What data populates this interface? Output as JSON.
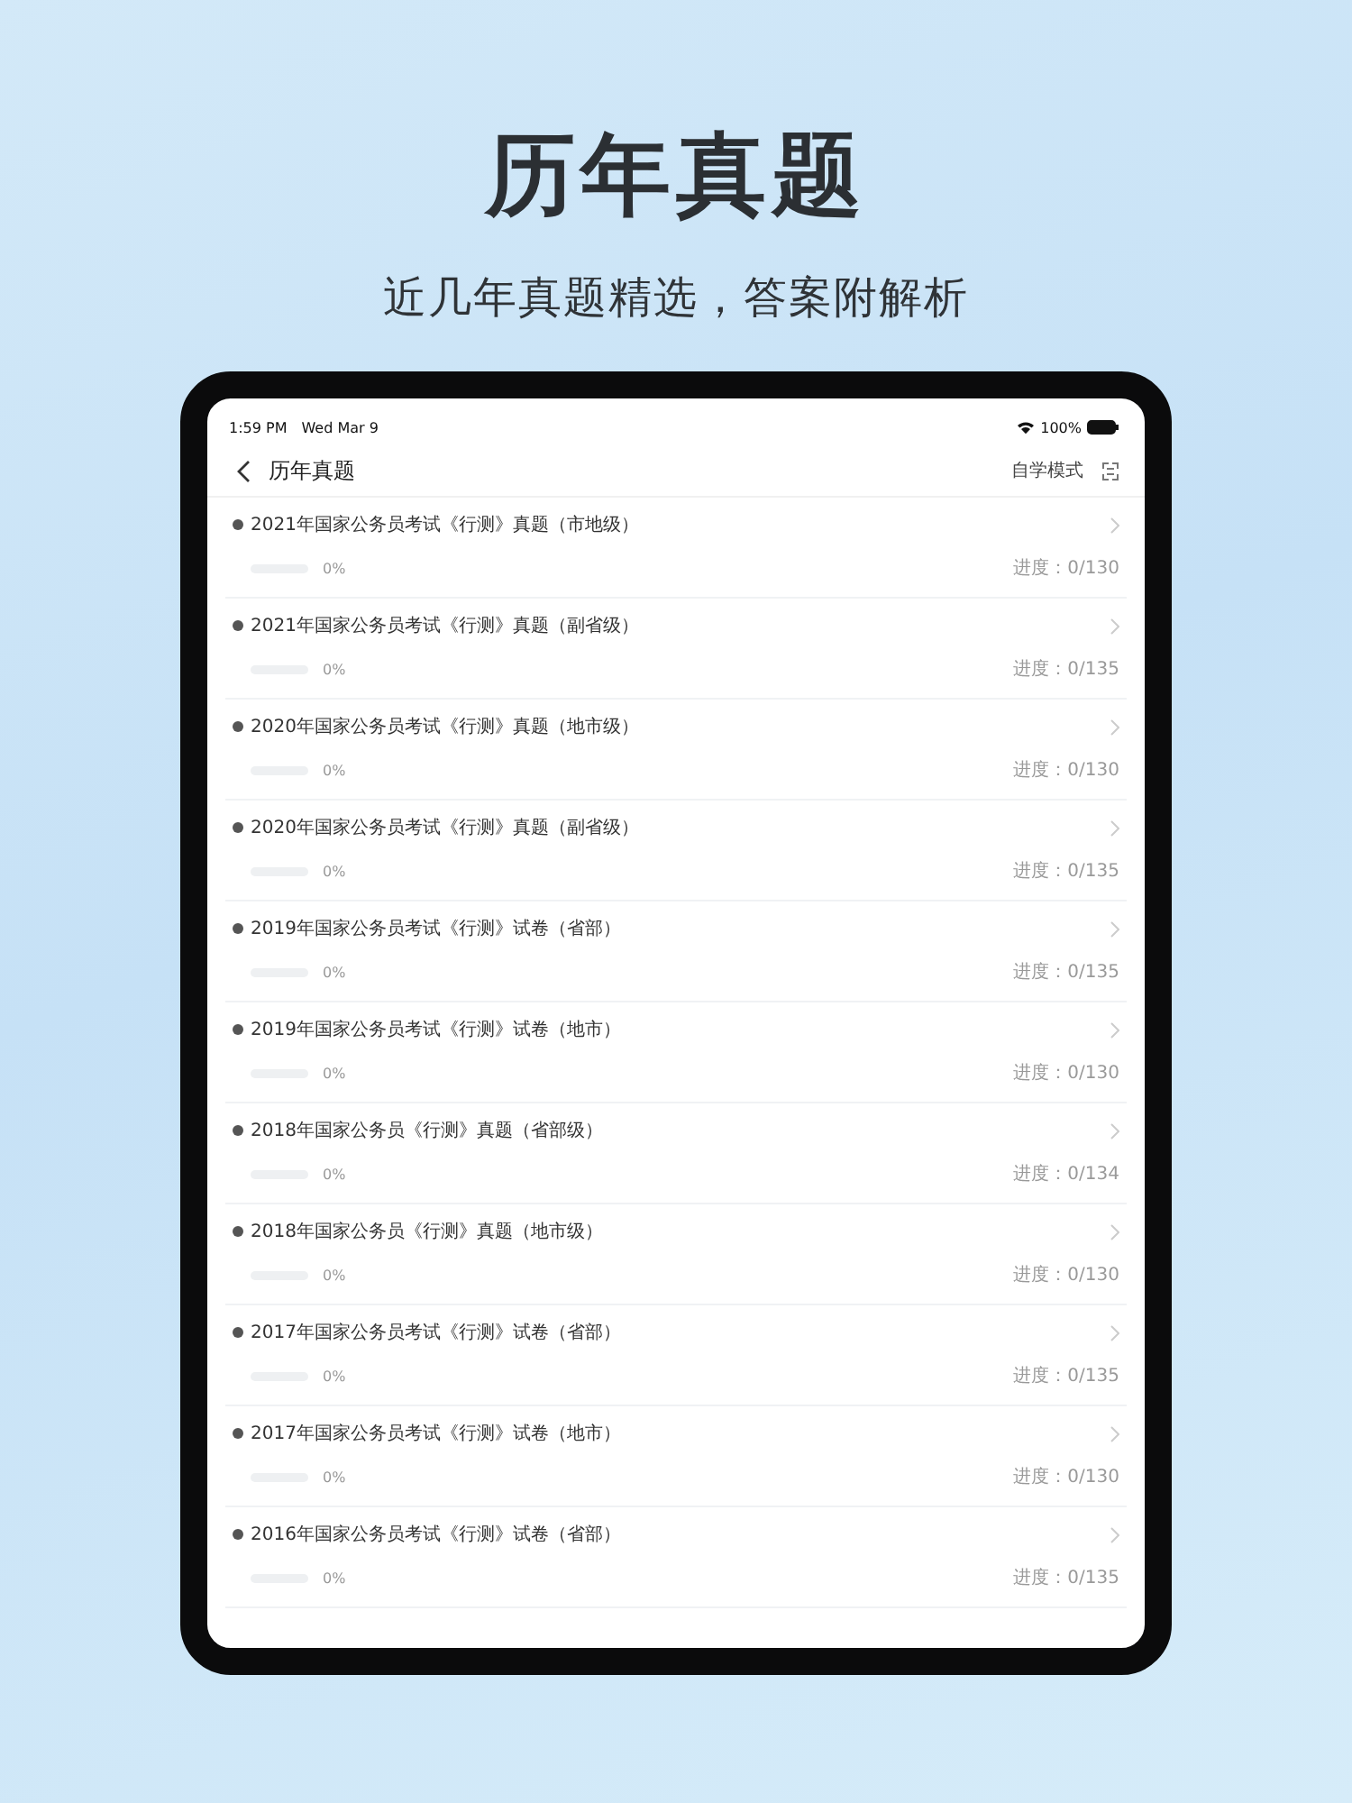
{
  "headline": "历年真题",
  "subtitle": "近几年真题精选，答案附解析",
  "status_bar": {
    "time": "1:59 PM",
    "date": "Wed Mar 9",
    "battery": "100%"
  },
  "nav": {
    "title": "历年真题",
    "mode": "自学模式"
  },
  "papers": [
    {
      "title": "2021年国家公务员考试《行测》真题（市地级）",
      "level": 0,
      "percent": "0%",
      "progress": "进度：0/130"
    },
    {
      "title": "2021年国家公务员考试《行测》真题（副省级）",
      "level": 0,
      "percent": "0%",
      "progress": "进度：0/135"
    },
    {
      "title": "2020年国家公务员考试《行测》真题（地市级）",
      "level": 0,
      "percent": "0%",
      "progress": "进度：0/130"
    },
    {
      "title": "2020年国家公务员考试《行测》真题（副省级）",
      "level": 0,
      "percent": "0%",
      "progress": "进度：0/135"
    },
    {
      "title": "2019年国家公务员考试《行测》试卷（省部）",
      "level": 0,
      "percent": "0%",
      "progress": "进度：0/135"
    },
    {
      "title": "2019年国家公务员考试《行测》试卷（地市）",
      "level": 0,
      "percent": "0%",
      "progress": "进度：0/130"
    },
    {
      "title": "2018年国家公务员《行测》真题（省部级）",
      "level": 0,
      "percent": "0%",
      "progress": "进度：0/134"
    },
    {
      "title": "2018年国家公务员《行测》真题（地市级）",
      "level": 0,
      "percent": "0%",
      "progress": "进度：0/130"
    },
    {
      "title": "2017年国家公务员考试《行测》试卷（省部）",
      "level": 0,
      "percent": "0%",
      "progress": "进度：0/135"
    },
    {
      "title": "2017年国家公务员考试《行测》试卷（地市）",
      "level": 0,
      "percent": "0%",
      "progress": "进度：0/130"
    },
    {
      "title": "2016年国家公务员考试《行测》试卷（省部）",
      "level": 0,
      "percent": "0%",
      "progress": "进度：0/135"
    }
  ]
}
